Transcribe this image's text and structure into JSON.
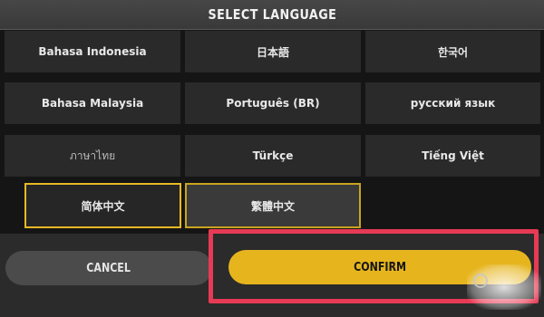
{
  "title": "SELECT LANGUAGE",
  "languages": [
    {
      "label": "Bahasa Indonesia",
      "state": "normal"
    },
    {
      "label": "日本語",
      "state": "normal"
    },
    {
      "label": "한국어",
      "state": "normal"
    },
    {
      "label": "Bahasa Malaysia",
      "state": "normal"
    },
    {
      "label": "Português (BR)",
      "state": "normal"
    },
    {
      "label": "русский язык",
      "state": "normal"
    },
    {
      "label": "ภาษาไทย",
      "state": "normal"
    },
    {
      "label": "Türkçe",
      "state": "normal"
    },
    {
      "label": "Tiếng Việt",
      "state": "normal"
    },
    {
      "label": "简体中文",
      "state": "selected"
    },
    {
      "label": "繁體中文",
      "state": "highlighted"
    }
  ],
  "buttons": {
    "cancel": "CANCEL",
    "confirm": "CONFIRM"
  },
  "colors": {
    "accent": "#e6b51e",
    "annotation": "#e73a55"
  }
}
